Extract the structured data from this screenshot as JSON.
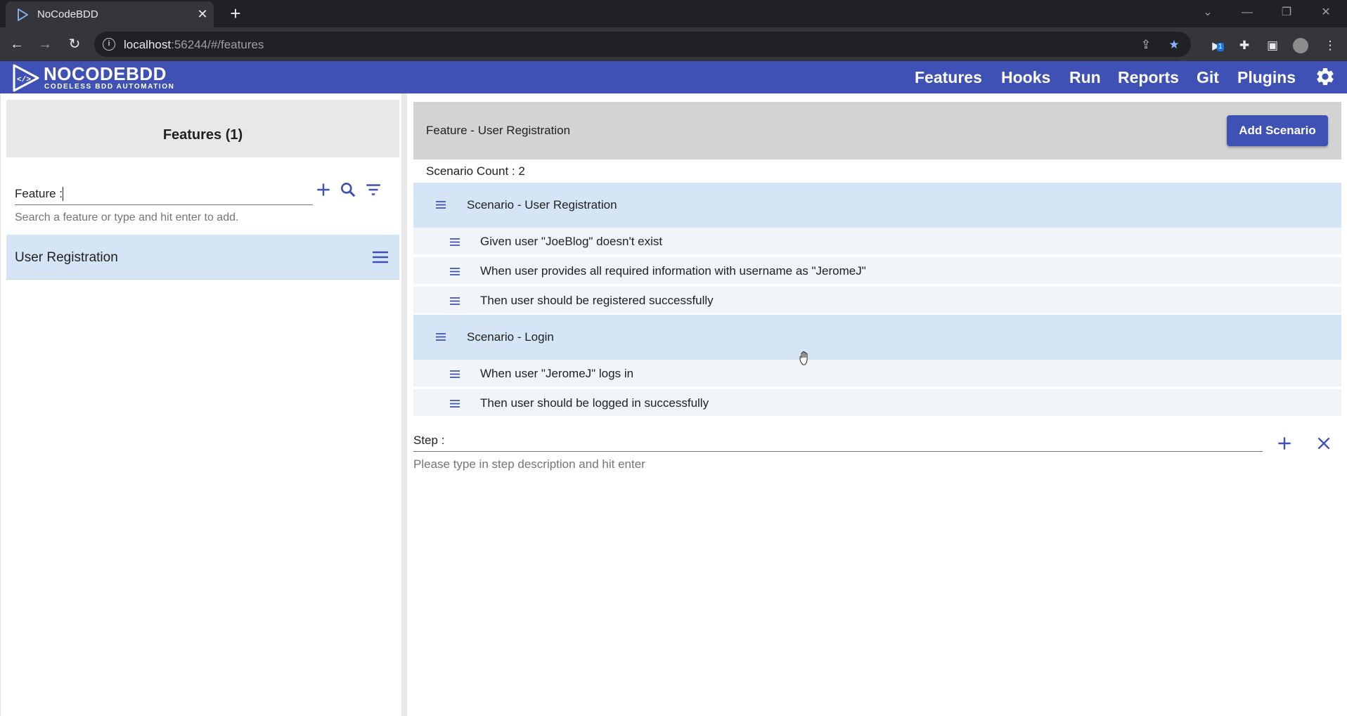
{
  "browser": {
    "tab_title": "NoCodeBDD",
    "url_host": "localhost",
    "url_rest": ":56244/#/features",
    "extension_badge": "1"
  },
  "app": {
    "logo_main": "NOCODEBDD",
    "logo_sub": "CODELESS BDD AUTOMATION",
    "nav": [
      "Features",
      "Hooks",
      "Run",
      "Reports",
      "Git",
      "Plugins"
    ],
    "accent_color": "#3f51b5"
  },
  "sidebar": {
    "header": "Features (1)",
    "feature_label": "Feature :",
    "feature_hint": "Search a feature or type and hit enter to add.",
    "features": [
      {
        "name": "User Registration"
      }
    ]
  },
  "main": {
    "feature_title": "Feature -  User Registration",
    "add_scenario_label": "Add Scenario",
    "scenario_count": "Scenario Count : 2",
    "scenarios": [
      {
        "title": "Scenario - User Registration",
        "steps": [
          "Given user \"JoeBlog\" doesn't exist",
          "When user provides all required information with username as \"JeromeJ\"",
          "Then user should be registered successfully"
        ]
      },
      {
        "title": "Scenario - Login",
        "steps": [
          "When user \"JeromeJ\" logs in",
          "Then user should be logged in successfully"
        ]
      }
    ],
    "step_label": "Step :",
    "step_hint": "Please type in step description and hit enter"
  }
}
